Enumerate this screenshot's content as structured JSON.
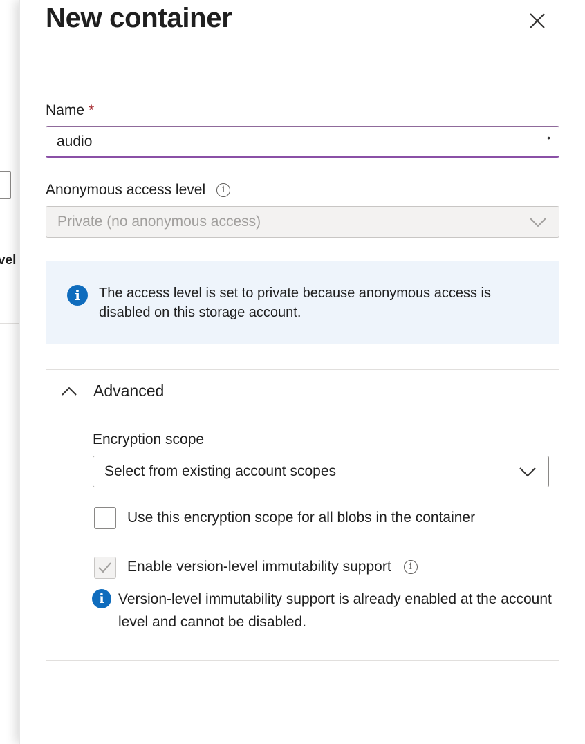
{
  "background": {
    "partial_label": "vel"
  },
  "dialog": {
    "title": "New container",
    "close_icon": "close-icon"
  },
  "name_field": {
    "label": "Name",
    "required_marker": "*",
    "value": "audio",
    "trailing_mark": "•"
  },
  "access_level": {
    "label": "Anonymous access level",
    "selected": "Private (no anonymous access)",
    "disabled": true
  },
  "info_banner": {
    "message": "The access level is set to private because anonymous access is disabled on this storage account."
  },
  "advanced": {
    "label": "Advanced",
    "expanded": true,
    "encryption_scope": {
      "label": "Encryption scope",
      "selected": "Select from existing account scopes"
    },
    "use_scope_checkbox": {
      "label": "Use this encryption scope for all blobs in the container",
      "checked": false
    },
    "immutability_checkbox": {
      "label": "Enable version-level immutability support",
      "checked": true,
      "disabled": true
    },
    "immutability_note": "Version-level immutability support is already enabled at the account level and cannot be disabled."
  },
  "colors": {
    "accent_info": "#0f6cbd",
    "focus_border": "#8a50a6",
    "required": "#a4262c",
    "info_bg": "#eef4fb"
  }
}
